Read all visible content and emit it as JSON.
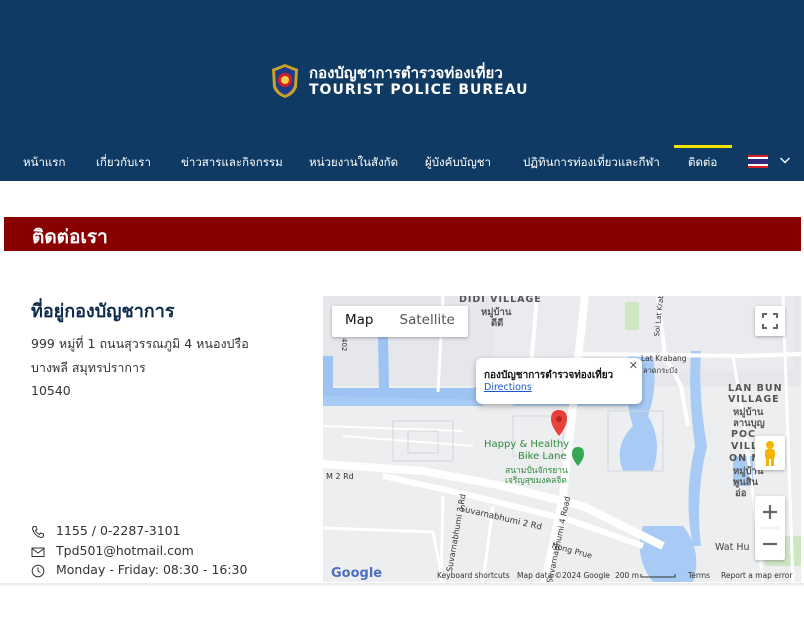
{
  "header": {
    "brand_th": "กองบัญชาการตำรวจท่องเที่ยว",
    "brand_en": "TOURIST POLICE BUREAU",
    "colors": {
      "background": "#0e3a63",
      "active_bar": "#f2e300"
    }
  },
  "nav": {
    "items": [
      {
        "label": "หน้าแรก"
      },
      {
        "label": "เกี่ยวกับเรา"
      },
      {
        "label": "ข่าวสารและกิจกรรม"
      },
      {
        "label": "หน่วยงานในสังกัด"
      },
      {
        "label": "ผู้บังคับบัญชา"
      },
      {
        "label": "ปฏิทินการท่องเที่ยวและกีฬา"
      },
      {
        "label": "ติดต่อ",
        "active": true
      }
    ],
    "language_icon": "thai-flag-icon"
  },
  "banner": {
    "title": "ติดต่อเรา",
    "color": "#8a0000"
  },
  "address": {
    "title": "ที่อยู่กองบัญชาการ",
    "lines": [
      "999 หมู่ที่ 1 ถนนสุวรรณภูมิ 4 หนองปรือ",
      "บางพลี สมุทรปราการ",
      "10540"
    ]
  },
  "contact": {
    "phone": "1155 / 0-2287-3101",
    "email": "Tpd501@hotmail.com",
    "hours": "Monday - Friday: 08:30 - 16:30"
  },
  "map": {
    "type_map": "Map",
    "type_satellite": "Satellite",
    "popup_title": "กองบัญชาการตำรวจท่องเที่ยว",
    "popup_link": "Directions",
    "labels": {
      "didi_village": "DIDI VILLAGE",
      "didi_th1": "หมู่บ้าน",
      "didi_th2": "ดีดี",
      "lan_bun": "LAN BUN",
      "lan_bun2": "VILLAGE",
      "lan_bun_th1": "หมู่บ้าน",
      "lan_bun_th2": "ลานบุญ",
      "poon_1": "POC",
      "poon_2": "VILL",
      "poon_3": "ON NOCH",
      "poon_th1": "หมู่บ้าน",
      "poon_th2": "พูนสิน",
      "poon_th3": "อ่อ",
      "bike_en1": "Happy & Healthy",
      "bike_en2": "Bike Lane",
      "bike_th1": "สนามปั่นจักรยาน",
      "bike_th2": "เจริญสุขมงคลจิต",
      "suvarnabhumi_2": "Suvarnabhumi 2 Rd",
      "suvarnabhumi_3": "Suvarnabhumi 3 Rd",
      "suvarnabhumi_4": "Suvarnabhumi 4 Road",
      "nong_prue": "Nong Prue",
      "m2rd": "M 2 Rd",
      "lat_krabang": "Lat Krabang",
      "lat_krabang_th": "ลาดกระบัง",
      "soi_lat_krabang": "Soi Lat Krabang",
      "wat_hu": "Wat Hu",
      "road_402": "402"
    },
    "footer": {
      "google": "Google",
      "shortcuts": "Keyboard shortcuts",
      "data": "Map data ©2024 Google",
      "scale": "200 m",
      "terms": "Terms",
      "report": "Report a map error"
    }
  }
}
